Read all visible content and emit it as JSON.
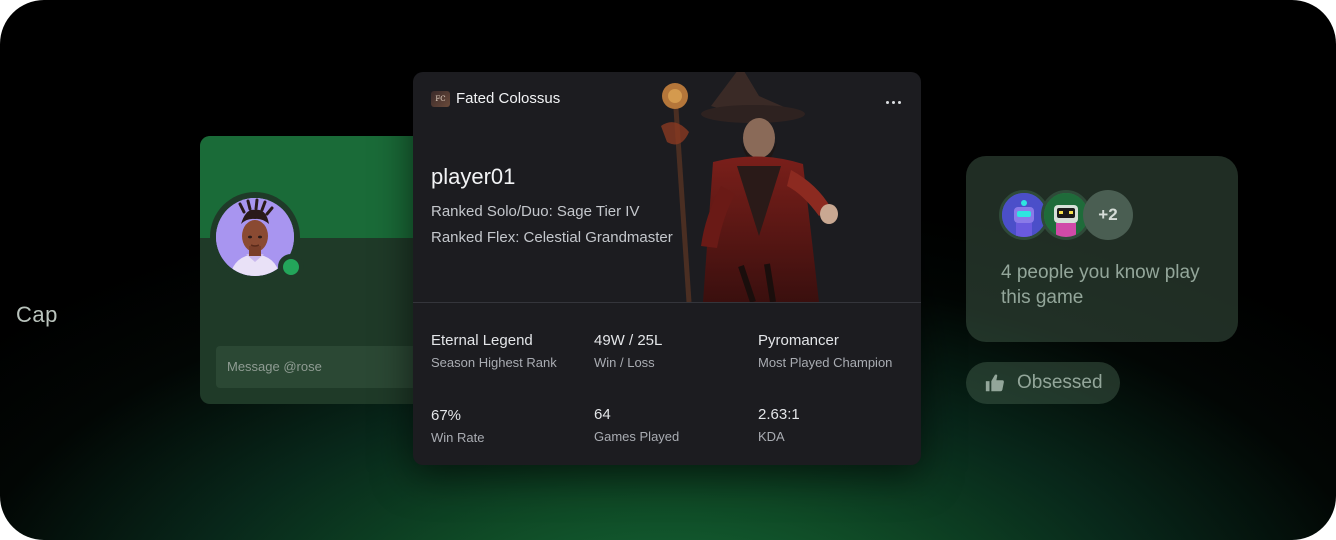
{
  "profile": {
    "name": "Cap",
    "message_placeholder": "Message @rose",
    "status": "online"
  },
  "game": {
    "title": "Fated Colossus",
    "player": "player01",
    "ranks": [
      "Ranked Solo/Duo: Sage Tier IV",
      "Ranked Flex: Celestial Grandmaster"
    ],
    "stats": [
      {
        "value": "Eternal Legend",
        "label": "Season Highest Rank"
      },
      {
        "value": "49W / 25L",
        "label": "Win / Loss"
      },
      {
        "value": "Pyromancer",
        "label": "Most Played Champion"
      },
      {
        "value": "67%",
        "label": "Win Rate"
      },
      {
        "value": "64",
        "label": "Games Played"
      },
      {
        "value": "2.63:1",
        "label": "KDA"
      }
    ]
  },
  "friends": {
    "extra_count": "+2",
    "text": "4 people you know play this game"
  },
  "reaction": {
    "icon": "thumbs-up-icon",
    "label": "Obsessed"
  },
  "colors": {
    "online": "#23a55a",
    "card": "#1c1c20",
    "profile_banner": "#1a6b38"
  }
}
